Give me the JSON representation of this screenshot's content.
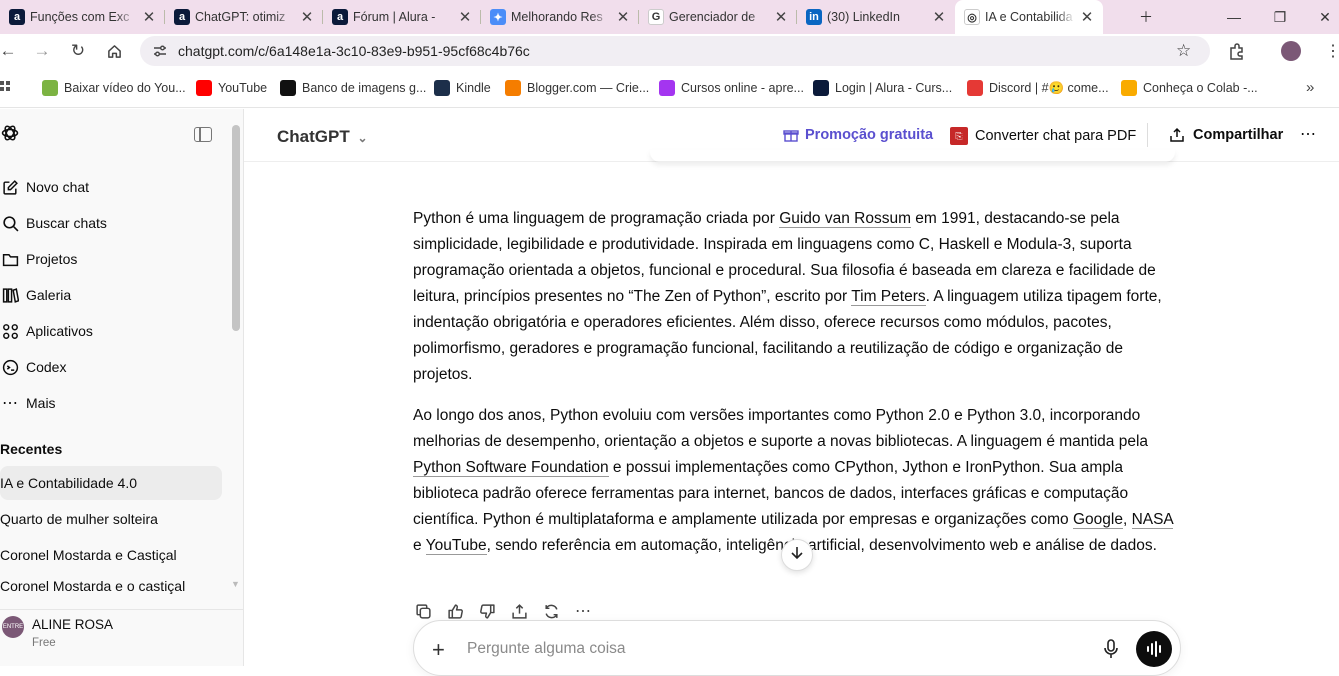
{
  "browser": {
    "tabs": [
      {
        "title": "Funções com Exc",
        "favicon": "alura-icon",
        "color": "#0b1a3a",
        "glyph": "a"
      },
      {
        "title": "ChatGPT: otimiz",
        "favicon": "alura-icon",
        "color": "#0b1a3a",
        "glyph": "a"
      },
      {
        "title": "Fórum | Alura - ",
        "favicon": "alura-icon",
        "color": "#0b1a3a",
        "glyph": "a"
      },
      {
        "title": "Melhorando Res",
        "favicon": "gemini-icon",
        "color": "#4b8df8",
        "glyph": "✦"
      },
      {
        "title": "Gerenciador de ",
        "favicon": "google-icon",
        "color": "#ffffff",
        "glyph": "G"
      },
      {
        "title": "(30) LinkedIn",
        "favicon": "linkedin-icon",
        "color": "#0a66c2",
        "glyph": "in"
      },
      {
        "title": "IA e Contabilida",
        "favicon": "chatgpt-icon",
        "color": "#ffffff",
        "glyph": "◎"
      }
    ],
    "url": "chatgpt.com/c/6a148e1a-3c10-83e9-b951-95cf68c4b76c",
    "bookmarks": [
      {
        "label": "Baixar vídeo do You...",
        "icon": "download-icon",
        "color": "#7cb342"
      },
      {
        "label": "YouTube",
        "icon": "youtube-icon",
        "color": "#ff0000"
      },
      {
        "label": "Banco de imagens g...",
        "icon": "bancodeimagens-icon",
        "color": "#111111"
      },
      {
        "label": "Kindle",
        "icon": "kindle-icon",
        "color": "#1c2f4a"
      },
      {
        "label": "Blogger.com — Crie...",
        "icon": "blogger-icon",
        "color": "#f57d00"
      },
      {
        "label": "Cursos online - apre...",
        "icon": "udemy-icon",
        "color": "#a435f0"
      },
      {
        "label": "Login | Alura - Curs...",
        "icon": "alura-icon",
        "color": "#0b1a3a"
      },
      {
        "label": "Discord | #🥲 come...",
        "icon": "discord-icon",
        "color": "#e53935"
      },
      {
        "label": "Conheça o Colab -...",
        "icon": "colab-icon",
        "color": "#f9ab00"
      }
    ]
  },
  "sidebar": {
    "items": [
      {
        "label": "Novo chat",
        "icon": "new-chat-icon"
      },
      {
        "label": "Buscar chats",
        "icon": "search-icon"
      },
      {
        "label": "Projetos",
        "icon": "folder-icon"
      },
      {
        "label": "Galeria",
        "icon": "gallery-icon"
      },
      {
        "label": "Aplicativos",
        "icon": "apps-icon"
      },
      {
        "label": "Codex",
        "icon": "codex-icon"
      },
      {
        "label": "Mais",
        "icon": "more-icon"
      }
    ],
    "recents_heading": "Recentes",
    "recents": [
      "IA e Contabilidade 4.0",
      "Quarto de mulher solteira",
      "Coronel Mostarda e Castiçal",
      "Coronel Mostarda e o castiçal"
    ],
    "user": {
      "name": "ALINE ROSA",
      "plan": "Free",
      "avatar_text": "ENTRE"
    }
  },
  "header": {
    "model": "ChatGPT",
    "promo": "Promoção gratuita",
    "convert": "Converter chat para PDF",
    "share": "Compartilhar"
  },
  "message": {
    "p1": [
      {
        "t": "Python é uma linguagem de programação criada por "
      },
      {
        "t": "Guido van Rossum",
        "link": true
      },
      {
        "t": " em 1991, destacando-se pela simplicidade, legibilidade e produtividade. Inspirada em linguagens como C, Haskell e Modula-3, suporta programação orientada a objetos, funcional e procedural. Sua filosofia é baseada em clareza e facilidade de leitura, princípios presentes no “The Zen of Python”, escrito por "
      },
      {
        "t": "Tim Peters",
        "link": true
      },
      {
        "t": ". A linguagem utiliza tipagem forte, indentação obrigatória e operadores eficientes. Além disso, oferece recursos como módulos, pacotes, polimorfismo, geradores e programação funcional, facilitando a reutilização de código e organização de projetos."
      }
    ],
    "p2": [
      {
        "t": "Ao longo dos anos, Python evoluiu com versões importantes como Python 2.0 e Python 3.0, incorporando melhorias de desempenho, orientação a objetos e suporte a novas bibliotecas. A linguagem é mantida pela "
      },
      {
        "t": "Python Software Foundation",
        "link": true
      },
      {
        "t": " e possui implementações como CPython, Jython e IronPython. Sua ampla biblioteca padrão oferece ferramentas para internet, bancos de dados, interfaces gráficas e computação científica. Python é multiplataforma e amplamente utilizada por empresas e organizações como "
      },
      {
        "t": "Google",
        "link": true
      },
      {
        "t": ", "
      },
      {
        "t": "NASA",
        "link": true
      },
      {
        "t": " e "
      },
      {
        "t": "YouTube",
        "link": true
      },
      {
        "t": ", sendo referência em automação, inteligência artificial, desenvolvimento web e análise de dados."
      }
    ]
  },
  "composer": {
    "placeholder": "Pergunte alguma coisa"
  },
  "colors": {
    "accent": "#5a4fcf",
    "pdf_red": "#c62828",
    "tabstrip": "#f1deec"
  }
}
